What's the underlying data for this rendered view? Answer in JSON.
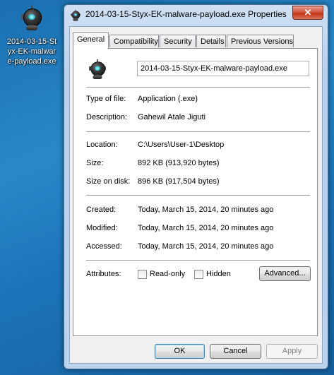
{
  "desktop": {
    "icon_label": "2014-03-15-Styx-EK-malware-payload.exe"
  },
  "window": {
    "title": "2014-03-15-Styx-EK-malware-payload.exe Properties",
    "close_symbol": "✕"
  },
  "tabs": [
    "General",
    "Compatibility",
    "Security",
    "Details",
    "Previous Versions"
  ],
  "general": {
    "filename": "2014-03-15-Styx-EK-malware-payload.exe",
    "type_label": "Type of file:",
    "type_value": "Application (.exe)",
    "description_label": "Description:",
    "description_value": "Gahewil Atale Jiguti",
    "location_label": "Location:",
    "location_value": "C:\\Users\\User-1\\Desktop",
    "size_label": "Size:",
    "size_value": "892 KB (913,920 bytes)",
    "size_on_disk_label": "Size on disk:",
    "size_on_disk_value": "896 KB (917,504 bytes)",
    "created_label": "Created:",
    "created_value": "Today, March 15, 2014, 20 minutes ago",
    "modified_label": "Modified:",
    "modified_value": "Today, March 15, 2014, 20 minutes ago",
    "accessed_label": "Accessed:",
    "accessed_value": "Today, March 15, 2014, 20 minutes ago",
    "attributes_label": "Attributes:",
    "readonly_label": "Read-only",
    "hidden_label": "Hidden",
    "advanced_label": "Advanced..."
  },
  "buttons": {
    "ok": "OK",
    "cancel": "Cancel",
    "apply": "Apply"
  },
  "icons": {
    "app": "robot-app-icon",
    "close": "close-icon"
  }
}
